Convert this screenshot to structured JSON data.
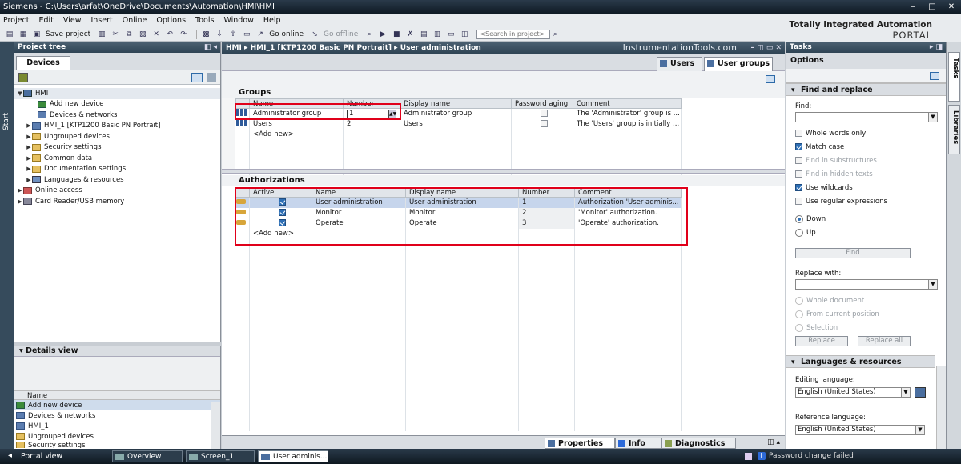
{
  "window": {
    "title": "Siemens  -  C:\\Users\\arfat\\OneDrive\\Documents\\Automation\\HMI\\HMI"
  },
  "menu": [
    "Project",
    "Edit",
    "View",
    "Insert",
    "Online",
    "Options",
    "Tools",
    "Window",
    "Help"
  ],
  "toolbar": {
    "save_project": "Save project",
    "go_online": "Go online",
    "go_offline": "Go offline",
    "search_placeholder": "<Search in project>"
  },
  "brand": {
    "line1": "Totally Integrated Automation",
    "line2": "PORTAL"
  },
  "start_rail": "Start",
  "project_tree": {
    "title": "Project tree",
    "tab": "Devices",
    "items": [
      {
        "label": "HMI",
        "level": 0,
        "icon": "hmi-icon"
      },
      {
        "label": "Add new device",
        "level": 1,
        "icon": "add-device-icon"
      },
      {
        "label": "Devices & networks",
        "level": 1,
        "icon": "network-icon"
      },
      {
        "label": "HMI_1 [KTP1200 Basic PN Portrait]",
        "level": 1,
        "icon": "hmi-device-icon"
      },
      {
        "label": "Ungrouped devices",
        "level": 1,
        "icon": "folder-icon"
      },
      {
        "label": "Security settings",
        "level": 1,
        "icon": "folder-icon"
      },
      {
        "label": "Common data",
        "level": 1,
        "icon": "folder-icon"
      },
      {
        "label": "Documentation settings",
        "level": 1,
        "icon": "folder-icon"
      },
      {
        "label": "Languages & resources",
        "level": 1,
        "icon": "language-icon"
      },
      {
        "label": "Online access",
        "level": 0,
        "icon": "online-access-icon"
      },
      {
        "label": "Card Reader/USB memory",
        "level": 0,
        "icon": "card-reader-icon"
      }
    ]
  },
  "details_view": {
    "title": "Details view",
    "column": "Name",
    "items": [
      "Add new device",
      "Devices & networks",
      "HMI_1",
      "Ungrouped devices",
      "Security settings"
    ]
  },
  "editor": {
    "breadcrumb": "HMI  ▸  HMI_1 [KTP1200 Basic PN Portrait]  ▸  User administration",
    "watermark": "InstrumentationTools.com",
    "tabs": {
      "users": "Users",
      "groups": "User groups"
    },
    "groups": {
      "title": "Groups",
      "columns": [
        "Name",
        "Number",
        "Display name",
        "Password aging",
        "Comment"
      ],
      "rows": [
        {
          "name": "Administrator group",
          "number": "1",
          "display": "Administrator group",
          "comment": "The 'Administrator' group is ..."
        },
        {
          "name": "Users",
          "number": "2",
          "display": "Users",
          "comment": "The 'Users' group is initially ..."
        }
      ],
      "add_new": "<Add new>"
    },
    "authorizations": {
      "title": "Authorizations",
      "columns": [
        "Active",
        "Name",
        "Display name",
        "Number",
        "Comment"
      ],
      "rows": [
        {
          "name": "User administration",
          "display": "User administration",
          "number": "1",
          "comment": "Authorization 'User adminis...",
          "active": true
        },
        {
          "name": "Monitor",
          "display": "Monitor",
          "number": "2",
          "comment": "'Monitor' authorization.",
          "active": true
        },
        {
          "name": "Operate",
          "display": "Operate",
          "number": "3",
          "comment": "'Operate' authorization.",
          "active": true
        }
      ],
      "add_new": "<Add new>"
    }
  },
  "properties_bar": {
    "properties": "Properties",
    "info": "Info",
    "diagnostics": "Diagnostics"
  },
  "tasks": {
    "title": "Tasks",
    "options": "Options",
    "find_replace": {
      "title": "Find and replace",
      "find_label": "Find:",
      "whole_words": "Whole words only",
      "match_case": "Match case",
      "substructures": "Find in substructures",
      "hidden_texts": "Find in hidden texts",
      "wildcards": "Use wildcards",
      "regex": "Use regular expressions",
      "down": "Down",
      "up": "Up",
      "find_button": "Find",
      "replace_label": "Replace with:",
      "whole_document": "Whole document",
      "from_current": "From current position",
      "selection": "Selection",
      "replace_button": "Replace",
      "replace_all_button": "Replace all"
    },
    "languages": {
      "title": "Languages & resources",
      "editing_label": "Editing language:",
      "editing_value": "English (United States)",
      "reference_label": "Reference language:",
      "reference_value": "English (United States)"
    }
  },
  "side_tabs": {
    "tasks": "Tasks",
    "libraries": "Libraries"
  },
  "statusbar": {
    "portal_view": "Portal view",
    "tabs": [
      "Overview",
      "Screen_1",
      "User adminis..."
    ],
    "message": "Password change failed"
  }
}
